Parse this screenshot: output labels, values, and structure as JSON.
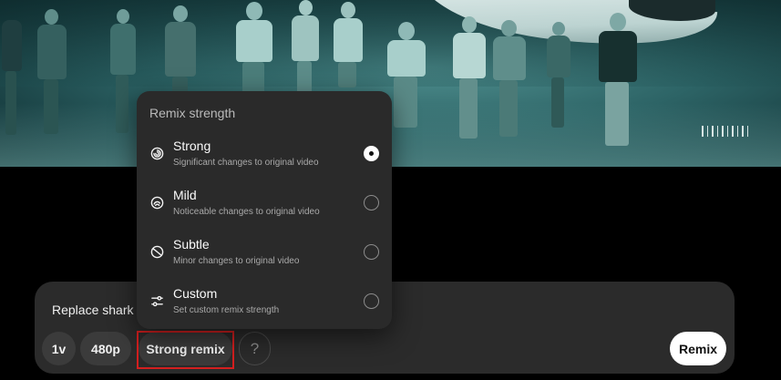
{
  "composer": {
    "prompt_text": "Replace shark v",
    "chips": {
      "count": "1v",
      "resolution": "480p",
      "remix_strength": "Strong remix",
      "help": "?"
    },
    "remix_button": "Remix"
  },
  "remix_menu": {
    "title": "Remix strength",
    "options": [
      {
        "label": "Strong",
        "description": "Significant changes to original video",
        "icon": "strong-spiral-icon",
        "selected": true
      },
      {
        "label": "Mild",
        "description": "Noticeable changes to original video",
        "icon": "mild-swirl-icon",
        "selected": false
      },
      {
        "label": "Subtle",
        "description": "Minor changes to original video",
        "icon": "subtle-circle-icon",
        "selected": false
      },
      {
        "label": "Custom",
        "description": "Set custom remix strength",
        "icon": "sliders-icon",
        "selected": false
      }
    ]
  },
  "colors": {
    "background": "#000000",
    "panel": "#2b2b2b",
    "menu": "#2a2a2a",
    "focus_ring": "#d41f1f",
    "video_tint": "#2d6466"
  }
}
